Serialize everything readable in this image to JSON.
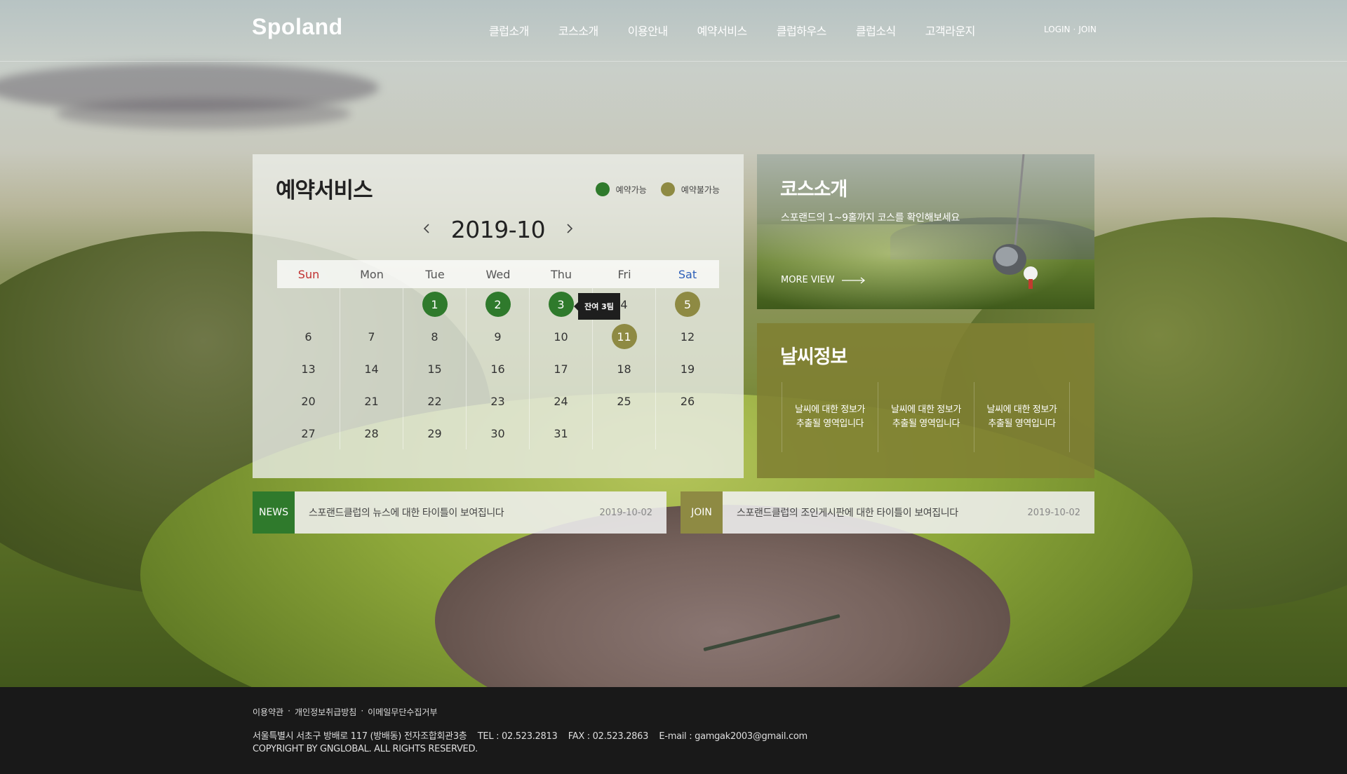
{
  "brand": {
    "logo": "Spoland"
  },
  "nav": {
    "items": [
      "클럽소개",
      "코스소개",
      "이용안내",
      "예약서비스",
      "클럽하우스",
      "클럽소식",
      "고객라운지"
    ],
    "login": "LOGIN",
    "separator": "·",
    "join": "JOIN"
  },
  "reservation": {
    "title": "예약서비스",
    "legend": {
      "available": "예약가능",
      "unavailable": "예약불가능"
    },
    "month": "2019-10",
    "weekdays": [
      "Sun",
      "Mon",
      "Tue",
      "Wed",
      "Thu",
      "Fri",
      "Sat"
    ],
    "days": [
      [
        "",
        "",
        "1",
        "2",
        "3",
        "4",
        "5"
      ],
      [
        "6",
        "7",
        "8",
        "9",
        "10",
        "11",
        "12"
      ],
      [
        "13",
        "14",
        "15",
        "16",
        "17",
        "18",
        "19"
      ],
      [
        "20",
        "21",
        "22",
        "23",
        "24",
        "25",
        "26"
      ],
      [
        "27",
        "28",
        "29",
        "30",
        "31",
        "",
        ""
      ]
    ],
    "available_days": [
      "1",
      "2",
      "3"
    ],
    "unavailable_days": [
      "5",
      "11"
    ],
    "tooltip": "잔여 3팀",
    "colors": {
      "available": "#2f7a2c",
      "unavailable": "#8e8a43",
      "sunday": "#c03030",
      "saturday": "#2d5fb8"
    }
  },
  "course": {
    "title": "코스소개",
    "desc": "스포랜드의 1~9홀까지 코스를 확인해보세요",
    "more": "MORE VIEW"
  },
  "weather": {
    "title": "날씨정보",
    "cols": [
      [
        "날씨에 대한 정보가",
        "추출될 영역입니다"
      ],
      [
        "날씨에 대한 정보가",
        "추출될 영역입니다"
      ],
      [
        "날씨에 대한 정보가",
        "추출될 영역입니다"
      ]
    ]
  },
  "news": {
    "tag": "NEWS",
    "text": "스포랜드클럽의 뉴스에 대한 타이틀이 보여집니다",
    "date": "2019-10-02",
    "color": "#2f7a2c"
  },
  "join": {
    "tag": "JOIN",
    "text": "스포랜드클럽의 조인게시판에 대한 타이틀이 보여집니다",
    "date": "2019-10-02",
    "color": "#8e8a43"
  },
  "footer": {
    "links": [
      "이용약관",
      "·",
      "개인정보취급방침",
      "·",
      "이메일무단수집거부"
    ],
    "address": "서울특별시 서초구 방배로 117 (방배동) 전자조합회관3층    TEL : 02.523.2813    FAX : 02.523.2863    E-mail : gamgak2003@gmail.com",
    "copyright": "COPYRIGHT BY GNGLOBAL. ALL RIGHTS RESERVED."
  }
}
